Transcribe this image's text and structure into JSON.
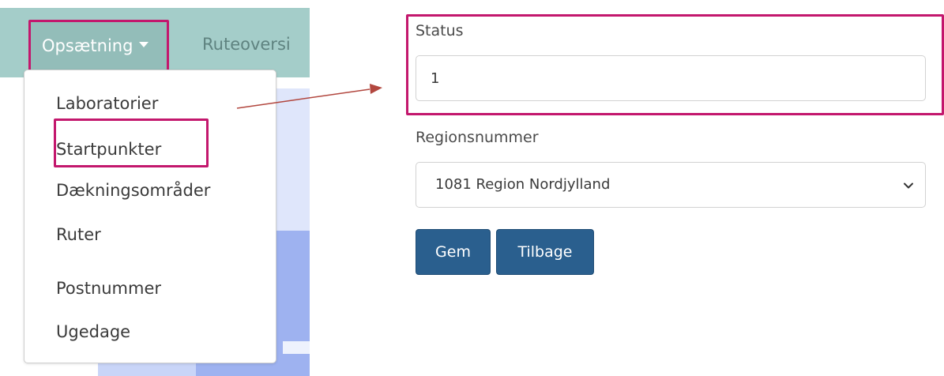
{
  "navbar": {
    "setup_label": "Opsætning",
    "routes_label": "Ruteoversi"
  },
  "dropdown": {
    "items": [
      {
        "label": "Laboratorier"
      },
      {
        "label": "Startpunkter"
      },
      {
        "label": "Dækningsområder"
      },
      {
        "label": "Ruter"
      },
      {
        "label": "Postnummer"
      },
      {
        "label": "Ugedage"
      }
    ]
  },
  "form": {
    "status_label": "Status",
    "status_value": "1",
    "region_label": "Regionsnummer",
    "region_selected": "1081 Region Nordjylland",
    "save_label": "Gem",
    "back_label": "Tilbage"
  },
  "colors": {
    "navbar": "#a4cdc9",
    "highlight": "#c3176d",
    "button": "#2a5f8e",
    "arrow": "#b2473f"
  },
  "icons": {
    "setup_caret": "caret-down-icon",
    "region_chevron": "chevron-down-icon",
    "arrow": "arrow-right-icon"
  }
}
